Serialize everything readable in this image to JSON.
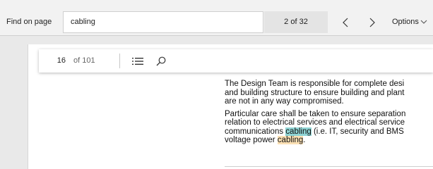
{
  "find_bar": {
    "label": "Find on page",
    "query": "cabling",
    "match_count": "2 of 32",
    "options_label": "Options"
  },
  "pdf_toolbar": {
    "current_page": "16",
    "total_pages": "of 101"
  },
  "document": {
    "para1": [
      "The Design Team is responsible for complete desi",
      "and building structure to ensure building and plant",
      "are not in any way compromised."
    ],
    "para2": {
      "line1": "Particular care shall be taken to ensure separation",
      "line2": "relation to electrical services and electrical service",
      "line3_before": "communications ",
      "line3_match": "cabling",
      "line3_after": " (i.e. IT, security and BMS",
      "line4_before": "voltage power ",
      "line4_match": "cabling",
      "line4_after": "."
    }
  },
  "colors": {
    "current_match": "#8fd4d4",
    "other_match": "#fbe0b4"
  }
}
